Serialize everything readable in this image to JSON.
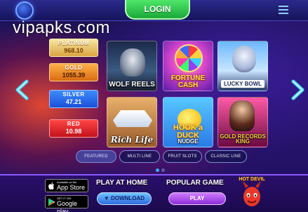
{
  "header": {
    "login_label": "LOGIN"
  },
  "watermark": "vipapks.com",
  "jackpots": [
    {
      "label": "PLATINUM",
      "value": "968.10"
    },
    {
      "label": "GOLD",
      "value": "1055.39"
    },
    {
      "label": "SILVER",
      "value": "47.21"
    },
    {
      "label": "RED",
      "value": "10.98"
    }
  ],
  "games": [
    {
      "name": "WOLF REELS"
    },
    {
      "name": "FORTUNE CASH"
    },
    {
      "name": "LUCKY BOWL"
    },
    {
      "name": "Rich Life"
    },
    {
      "name": "HOOK a DUCK",
      "subtitle": "NUDGE"
    },
    {
      "name": "GOLD RECORDS",
      "subtitle": "KING"
    }
  ],
  "tabs": [
    "FEATURED",
    "MULTI LINE",
    "FRUIT SLOTS",
    "CLASSIC LINE"
  ],
  "pager": {
    "pages": 2,
    "current": 1
  },
  "bottom": {
    "apple": {
      "small": "Available on the",
      "big": "App Store"
    },
    "google": {
      "small": "GET IT ON",
      "big": "Google play"
    },
    "play_at_home": "PLAY AT HOME",
    "download_label": "DOWNLOAD",
    "popular_game": "POPULAR GAME",
    "play_label": "PLAY",
    "featured_game": "HOT DEVIL"
  },
  "colors": {
    "login_green": "#2ac14a",
    "accent_blue": "#2f6ae0",
    "accent_purple": "#8b2ed8"
  }
}
